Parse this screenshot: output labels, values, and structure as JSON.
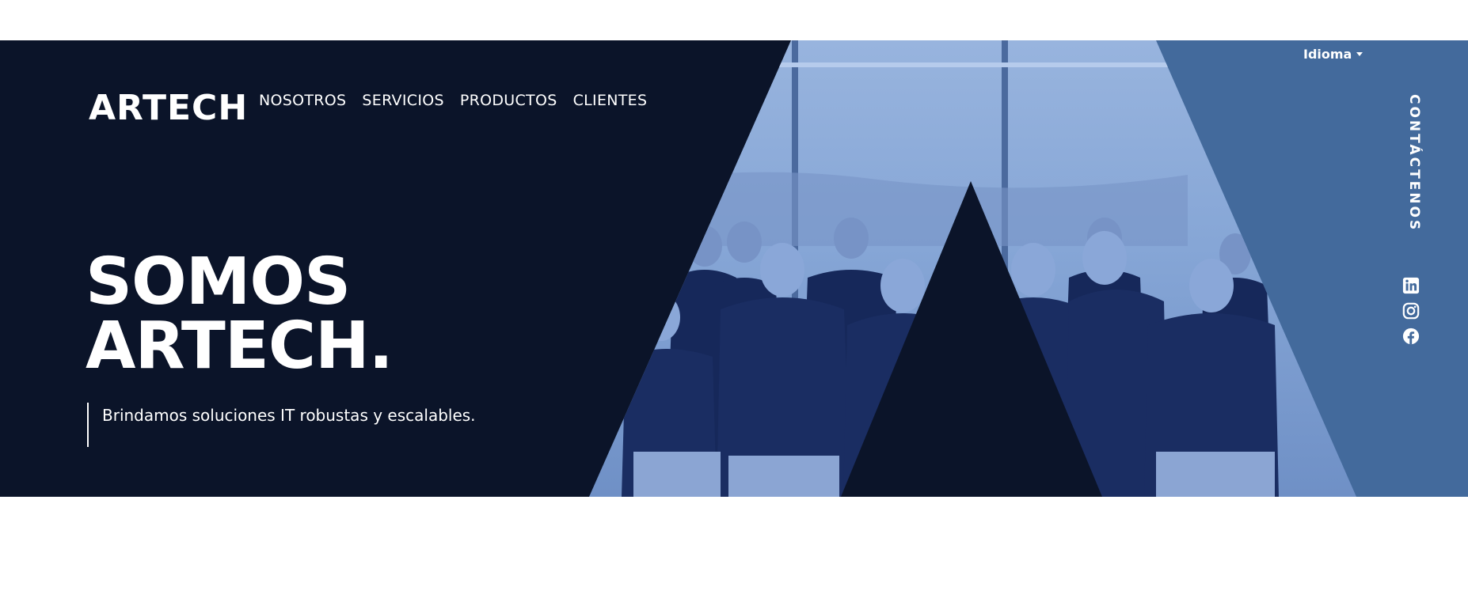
{
  "brand": {
    "logo_text": "ARTECH"
  },
  "nav": {
    "items": [
      "NOSOTROS",
      "SERVICIOS",
      "PRODUCTOS",
      "CLIENTES"
    ]
  },
  "language": {
    "label": "Idioma"
  },
  "contact": {
    "label": "CONTÁCTENOS"
  },
  "social": {
    "icons": [
      "linkedin-icon",
      "instagram-icon",
      "facebook-icon"
    ]
  },
  "hero": {
    "headline_line1": "SOMOS",
    "headline_line2": "ARTECH.",
    "tagline": "Brindamos soluciones IT robustas y escalables."
  },
  "colors": {
    "navy": "#0b1429",
    "accent_blue": "#436a9c",
    "photo_tint": "#7d9fd3"
  }
}
